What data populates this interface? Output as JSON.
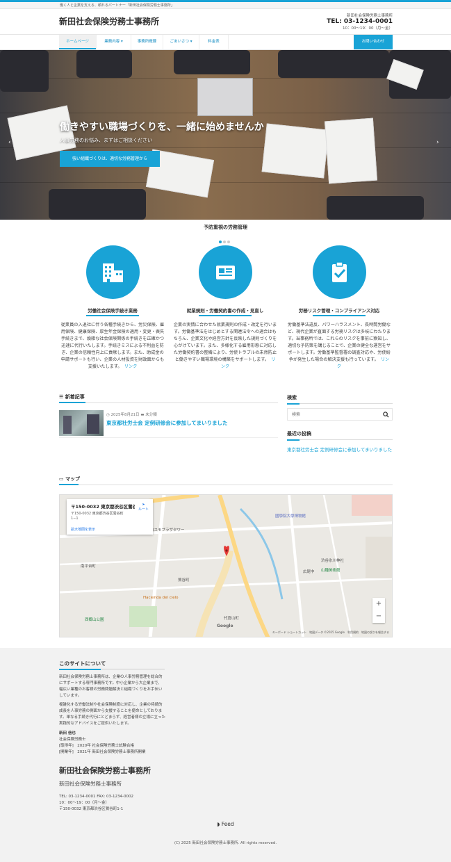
{
  "topbar": {
    "tagline": "働く人と企業を支える、頼れるパートナー「新田社会保険労務士事務所」"
  },
  "header": {
    "site_title": "新田社会保険労務士事務所",
    "office_name": "新田社会保険労務士事務所",
    "tel": "TEL: 03-1234-0001",
    "hours": "10：00〜19：00（月〜金）"
  },
  "nav": {
    "items": [
      {
        "label": "ホームページ"
      },
      {
        "label": "業務内容 ▾"
      },
      {
        "label": "事務所概要"
      },
      {
        "label": "ごあいさつ ▾"
      },
      {
        "label": "料金表"
      }
    ],
    "cta": "お問い合わせ"
  },
  "hero": {
    "title": "働きやすい職場づくりを、一緒に始めませんか",
    "subtitle": "人事労務のお悩み、まずはご相談ください",
    "button": "強い組織づくりは、適切な労務管理から",
    "prev": "‹",
    "next": "›"
  },
  "features_title": "予防重視の労務管理",
  "features": [
    {
      "title": "労働社会保険手続き業務",
      "text": "従業員の入退社に伴う各種手続きから、労災保険、雇用保険、健康保険、厚生年金保険の適用・変更・喪失手続きまで、煩雑な社会保険関係の手続きを正確かつ迅速に代行いたします。手続きミスによる不利益を防ぎ、企業の信頼性向上に貢献します。また、助成金の申請サポートも行い、企業の人材投資を財政面からも支援いたします。",
      "link": "リンク"
    },
    {
      "title": "就業規則・労働契約書の作成・見直し",
      "text": "企業の実情に合わせた就業規則の作成・改定を行います。労働基準法をはじめとする関連法令への適合はもちろん、企業文化や経営方針を反映した規則づくりを心がけています。また、多様化する雇用形態に対応した労働契約書の整備により、労使トラブルの未然防止と働きやすい職場環境の構築をサポートします。",
      "link": "リンク"
    },
    {
      "title": "労務リスク管理・コンプライアンス対応",
      "text": "労働基準法違反、パワーハラスメント、長時間労働など、現代企業が直面する労務リスクは多岐にわたります。当事務所では、これらのリスクを事前に察知し、適切な予防策を講じることで、企業の健全な運営をサポートします。労働基準監督署の調査対応や、労使紛争が発生した場合の解決支援も行っています。",
      "link": "リンク"
    }
  ],
  "news": {
    "heading": "新着記事",
    "items": [
      {
        "date": "2025年8月21日",
        "category": "未分類",
        "title": "東京都社労士会 定例研修会に参加してまいりました"
      }
    ]
  },
  "sidebar": {
    "search_heading": "検索",
    "search_placeholder": "検索",
    "recent_heading": "最近の投稿",
    "recent_items": [
      "東京都社労士会 定例研修会に参加してまいりました"
    ]
  },
  "map": {
    "heading": "マップ",
    "info_name": "〒150-0032 東京都渋谷区鶯谷...",
    "info_address": "〒150-0032 東京都渋谷区鶯谷町1−1",
    "route": "ルート",
    "enlarge": "拡大地図を表示",
    "labels": [
      "國學院大學博物館",
      "南平台町",
      "鶯谷町",
      "代官山町",
      "広尾中",
      "渋谷氷川神社",
      "山種美術館",
      "Hacienda del cielo",
      "西郷山公園",
      "コスモプラザタワー"
    ],
    "footer": "キーボード ショートカット　地図データ ©2025 Google　利用規約　地図の誤りを報告する",
    "google": "Google",
    "zoom_in": "+",
    "zoom_out": "−"
  },
  "footer": {
    "about_heading": "このサイトについて",
    "about_p1": "新田社会保険労務士事務所は、企業の人事労務管理を総合的にサポートする専門事務所です。中小企業から大企業まで、幅広い業種のお客様の労務問題解決と組織づくりをお手伝いしています。",
    "about_p2": "複雑化する労働法制や社会保険制度に対応し、企業の持続的成長を人事労務の側面から支援することを使命としております。単なる手続き代行にとどまらず、経営者様の立場に立った実践的なアドバイスをご提供いたします。",
    "profile_name": "新田 信也",
    "profile_title": "社会保険労務士",
    "profile_line1": "[取得年]　2020年 社会保険労務士試験合格",
    "profile_line2": "[開業年]　2021年 新田社会保険労務士事務所開業",
    "name": "新田社会保険労務士事務所",
    "sub": "新田社会保険労務士事務所",
    "contact1": "TEL: 03-1234-0001 FAX: 03-1234-0002",
    "contact2": "10：00〜19：00（月〜金）",
    "contact3": "〒150-0032 東京都渋谷区鶯谷町1-1",
    "feed": "Feed",
    "copyright": "(C) 2025 新田社会保険労務士事務所. All rights reserved."
  },
  "colors": {
    "accent": "#19a3d6"
  }
}
